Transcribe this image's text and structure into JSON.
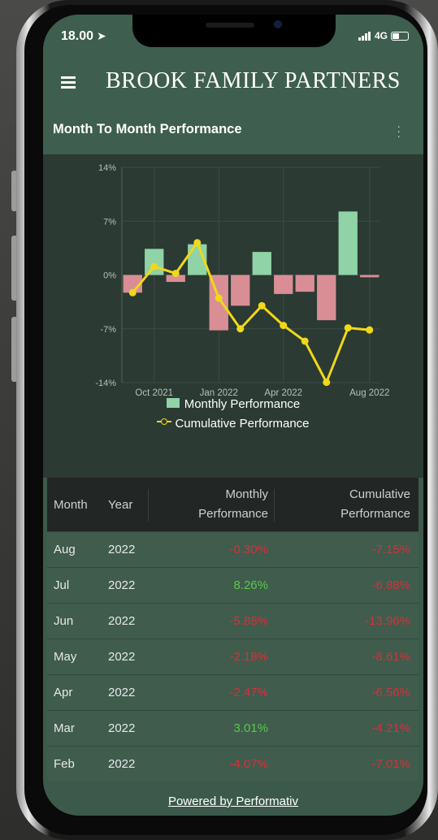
{
  "status_bar": {
    "time": "18.00",
    "network": "4G"
  },
  "app": {
    "brand": "BROOK FAMILY PARTNERS"
  },
  "card": {
    "title": "Month To Month Performance"
  },
  "chart_data": {
    "type": "bar",
    "x_ticks": [
      "Oct 2021",
      "Jan 2022",
      "Apr 2022",
      "Aug 2022"
    ],
    "y_ticks": [
      "14%",
      "7%",
      "0%",
      "-7%",
      "-14%"
    ],
    "ylim": [
      -14,
      14
    ],
    "grid": true,
    "legend_position": "bottom",
    "series": [
      {
        "name": "Monthly Performance",
        "kind": "bar",
        "color": "#8fd3a6",
        "neg_color": "#d98e95",
        "values": [
          -2.3,
          3.4,
          -0.9,
          4.0,
          -7.2,
          -4.0,
          3.0,
          -2.47,
          -2.18,
          -5.88,
          8.26,
          -0.3
        ]
      },
      {
        "name": "Cumulative Performance",
        "kind": "line",
        "color": "#f0d81a",
        "values": [
          -2.3,
          1.1,
          0.2,
          4.2,
          -3.0,
          -7.0,
          -4.0,
          -6.56,
          -8.61,
          -13.96,
          -6.88,
          -7.15
        ]
      }
    ]
  },
  "table": {
    "headers": {
      "month": "Month",
      "year": "Year",
      "monthly_1": "Monthly",
      "monthly_2": "Performance",
      "cumulative_1": "Cumulative",
      "cumulative_2": "Performance"
    },
    "rows": [
      {
        "month": "Aug",
        "year": "2022",
        "monthly": "-0.30%",
        "cumulative": "-7.15%"
      },
      {
        "month": "Jul",
        "year": "2022",
        "monthly": "8.26%",
        "cumulative": "-6.88%"
      },
      {
        "month": "Jun",
        "year": "2022",
        "monthly": "-5.88%",
        "cumulative": "-13.96%"
      },
      {
        "month": "May",
        "year": "2022",
        "monthly": "-2.18%",
        "cumulative": "-8.61%"
      },
      {
        "month": "Apr",
        "year": "2022",
        "monthly": "-2.47%",
        "cumulative": "-6.56%"
      },
      {
        "month": "Mar",
        "year": "2022",
        "monthly": "3.01%",
        "cumulative": "-4.21%"
      },
      {
        "month": "Feb",
        "year": "2022",
        "monthly": "-4.07%",
        "cumulative": "-7.01%"
      }
    ]
  },
  "footer": {
    "text": "Powered by Performativ"
  }
}
